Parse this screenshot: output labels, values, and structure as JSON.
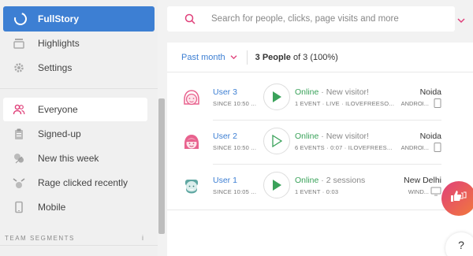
{
  "sidebar": {
    "brand": "FullStory",
    "items": [
      {
        "label": "Highlights",
        "icon": "highlights-icon"
      },
      {
        "label": "Settings",
        "icon": "gear-icon"
      }
    ],
    "segments": [
      {
        "label": "Everyone",
        "icon": "people-icon",
        "active": true
      },
      {
        "label": "Signed-up",
        "icon": "clipboard-icon"
      },
      {
        "label": "New this week",
        "icon": "leaf-icon"
      },
      {
        "label": "Rage clicked recently",
        "icon": "rage-icon"
      },
      {
        "label": "Mobile",
        "icon": "mobile-icon"
      }
    ],
    "team_segments_label": "TEAM SEGMENTS",
    "team_segments_info": "i"
  },
  "search": {
    "placeholder": "Search for people, clicks, page visits and more"
  },
  "header": {
    "period": "Past month",
    "count_bold": "3 People",
    "count_rest": " of 3 (100%)"
  },
  "sessions": [
    {
      "name": "User 3",
      "since": "SINCE 10:50 ...",
      "status": "Online",
      "note": " · New visitor!",
      "meta": "1 EVENT · LIVE · ILOVEFREESO...",
      "city": "Noida",
      "device": "ANDROI...",
      "playing": true
    },
    {
      "name": "User 2",
      "since": "SINCE 10:50 ...",
      "status": "Online",
      "note": " · New visitor!",
      "meta": "6 EVENTS · 0:07 · ILOVEFREES...",
      "city": "Noida",
      "device": "ANDROI...",
      "playing": false
    },
    {
      "name": "User 1",
      "since": "SINCE 10:05 ...",
      "status": "Online",
      "note": " · 2 sessions",
      "meta": "1 EVENT · 0:03",
      "city": "New Delhi",
      "device": "WIND...",
      "playing": true
    }
  ],
  "help": "?",
  "colors": {
    "accent": "#3d7fd3",
    "online": "#3aa25a",
    "avatar_pink": "#e8628e",
    "avatar_teal": "#5fa7a2"
  }
}
